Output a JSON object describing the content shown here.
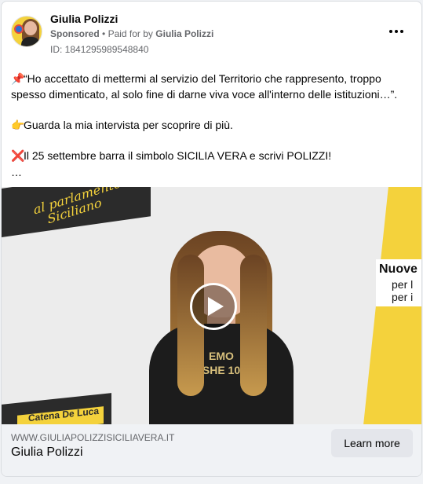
{
  "ad": {
    "page_name": "Giulia Polizzi",
    "sponsored": "Sponsored",
    "separator": "•",
    "paid_for_prefix": "Paid for by",
    "paid_for_name": "Giulia Polizzi",
    "ad_id": "ID: 1841295989548840",
    "more_icon": "ellipsis-icon"
  },
  "body": {
    "para1_emoji": "📌",
    "para1": "“Ho accettato di mettermi al servizio del Territorio che rappresento, troppo spesso dimenticato, al solo fine di darne viva voce all'interno delle istituzioni…”.",
    "para2_emoji": "👉",
    "para2": "Guarda la mia intervista per scoprire di più.",
    "para3_emoji": "❌",
    "para3": "Il 25 settembre barra il simbolo SICILIA VERA e scrivi POLIZZI!",
    "ellipsis": "…"
  },
  "media": {
    "banner_top_left_line1": "al parlamento",
    "banner_top_left_line2": "Siciliano",
    "banner_bottom_left": "Catena De Luca",
    "right_label_1": "Nuove",
    "right_label_2": "per l",
    "right_label_3": "per i",
    "shirt_text": "EMO SHE 10",
    "play_icon": "play-icon"
  },
  "footer": {
    "domain": "WWW.GIULIAPOLIZZISICILIAVERA.IT",
    "title": "Giulia Polizzi",
    "cta_label": "Learn more"
  }
}
